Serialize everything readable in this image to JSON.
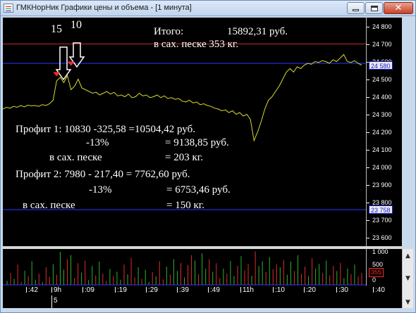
{
  "window": {
    "title": "ГМКНорНик Графики цены и объема - [1 минута]",
    "buttons": {
      "minimize": "minimize",
      "maximize": "maximize",
      "close": "✕"
    }
  },
  "annotations": {
    "arrow_label_left": "15",
    "arrow_label_right": "10",
    "total_label": "Итого:",
    "total_value": "15892,31 руб.",
    "total_sand": "в сах. песке  353 кг.",
    "profit1_line": "Профит 1: 10830 -325,58 =10504,42 руб.",
    "profit1_tax": "-13%",
    "profit1_net": "= 9138,85 руб.",
    "profit1_sand_label": "в сах. песке",
    "profit1_sand_value": "= 203 кг.",
    "profit2_line": "Профит 2:  7980 - 217,40 = 7762,60 руб.",
    "profit2_tax": "-13%",
    "profit2_net": "= 6753,46 руб.",
    "profit2_sand_label": "в сах. песке",
    "profit2_sand_value": "= 150 кг."
  },
  "price_axis": {
    "ticks": [
      "24 800",
      "24 700",
      "24 600",
      "24 500",
      "24 400",
      "24 300",
      "24 200",
      "24 100",
      "24 000",
      "23 900",
      "23 800",
      "23 700",
      "23 600"
    ],
    "tick_values": [
      24800,
      24700,
      24600,
      24500,
      24400,
      24300,
      24200,
      24100,
      24000,
      23900,
      23800,
      23700,
      23600
    ],
    "current_badge": "24 580",
    "low_badge": "23 758"
  },
  "volume_axis": {
    "ticks": [
      "1 000",
      "500",
      "0"
    ],
    "badge": "355"
  },
  "time_axis": {
    "ticks": [
      ":42",
      "9h",
      ":09",
      ":19",
      ":29",
      ":39",
      ":49",
      "11h",
      ":10",
      ":20",
      ":30",
      ":40"
    ],
    "bottom_label": "5"
  },
  "chart_data": {
    "type": "line",
    "ylim": [
      23550,
      24850
    ],
    "reference_lines": [
      {
        "value": 24700,
        "color": "#c0282a"
      },
      {
        "value": 24590,
        "color": "#2a3cff"
      },
      {
        "value": 23758,
        "color": "#2a3cff"
      }
    ],
    "series": [
      {
        "color": "#d9d92a",
        "values": [
          24330,
          24340,
          24335,
          24345,
          24340,
          24350,
          24342,
          24352,
          24348,
          24350,
          24345,
          24355,
          24350,
          24360,
          24380,
          24490,
          24510,
          24480,
          24520,
          24440,
          24460,
          24500,
          24450,
          24440,
          24430,
          24420,
          24425,
          24410,
          24420,
          24430,
          24415,
          24425,
          24405,
          24410,
          24400,
          24415,
          24395,
          24400,
          24420,
          24405,
          24410,
          24395,
          24400,
          24410,
          24395,
          24405,
          24390,
          24395,
          24385,
          24390,
          24375,
          24370,
          24380,
          24365,
          24370,
          24355,
          24360,
          24350,
          24345,
          24335,
          24330,
          24320,
          24325,
          24310,
          24320,
          24300,
          24310,
          24290,
          24300,
          24270,
          24150,
          24200,
          24260,
          24330,
          24380,
          24400,
          24430,
          24460,
          24500,
          24540,
          24560,
          24540,
          24570,
          24560,
          24580,
          24590,
          24585,
          24600,
          24595,
          24605,
          24600,
          24590,
          24610,
          24600,
          24620,
          24640,
          24600,
          24595,
          24605,
          24590,
          24580
        ]
      }
    ],
    "markers": [
      {
        "index": 15,
        "value": 24520,
        "color": "#ff2a2a"
      },
      {
        "index": 19,
        "value": 24580,
        "color": "#ff2a2a"
      }
    ],
    "volume": {
      "ymax": 1000,
      "values": [
        120,
        350,
        180,
        600,
        90,
        420,
        260,
        700,
        150,
        330,
        80,
        520,
        240,
        610,
        300,
        980,
        450,
        760,
        880,
        200,
        640,
        360,
        720,
        140,
        560,
        280,
        690,
        330,
        120,
        470,
        260,
        390,
        150,
        600,
        310,
        800,
        220,
        520,
        180,
        450,
        90,
        380,
        250,
        700,
        160,
        540,
        300,
        760,
        410,
        650,
        220,
        590,
        880,
        720,
        310,
        930,
        480,
        760,
        390,
        640,
        200,
        480,
        330,
        710,
        260,
        560,
        850,
        430,
        620,
        270,
        990,
        560,
        700,
        380,
        820,
        460,
        610,
        520,
        740,
        300,
        690,
        410,
        880,
        330,
        540,
        260,
        790,
        480,
        620,
        350,
        720,
        280,
        560,
        410,
        650,
        200,
        480,
        320,
        600,
        250,
        355
      ],
      "colors_pattern": [
        "#2bb52b",
        "#e02b2b"
      ]
    }
  }
}
